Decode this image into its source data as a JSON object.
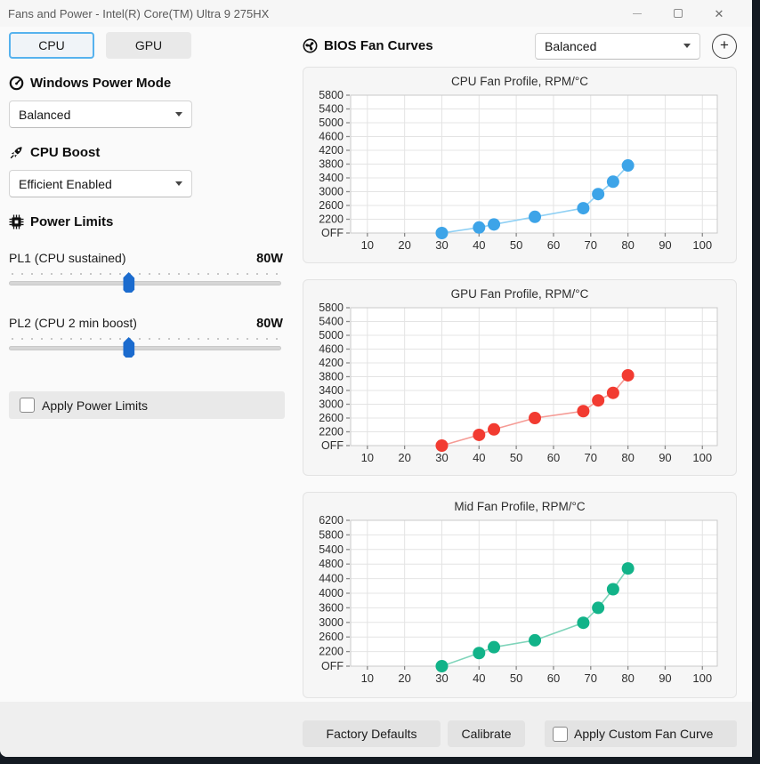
{
  "window": {
    "title": "Fans and Power - Intel(R) Core(TM) Ultra 9 275HX",
    "close_glyph": "✕"
  },
  "sidebar": {
    "tabs": [
      {
        "label": "CPU"
      },
      {
        "label": "GPU"
      }
    ],
    "active_tab": "CPU",
    "power_mode": {
      "heading": "Windows Power Mode",
      "value": "Balanced"
    },
    "cpu_boost": {
      "heading": "CPU Boost",
      "value": "Efficient Enabled"
    },
    "power_limits": {
      "heading": "Power Limits",
      "sliders": [
        {
          "label": "PL1 (CPU sustained)",
          "value": "80W",
          "percent": 44
        },
        {
          "label": "PL2 (CPU 2 min boost)",
          "value": "80W",
          "percent": 44
        }
      ],
      "apply_label": "Apply Power Limits",
      "apply_checked": false
    }
  },
  "fan_panel": {
    "heading": "BIOS Fan Curves",
    "preset": "Balanced",
    "add_glyph": "+",
    "footer": {
      "factory_defaults": "Factory Defaults",
      "calibrate": "Calibrate",
      "apply_custom": "Apply Custom Fan Curve",
      "apply_custom_checked": false
    }
  },
  "chart_data": [
    {
      "type": "scatter",
      "title": "CPU Fan Profile, RPM/°C",
      "x_ticks": [
        10,
        20,
        30,
        40,
        50,
        60,
        70,
        80,
        90,
        100
      ],
      "y_ticks_bottom_to_top": [
        "OFF",
        "2200",
        "2600",
        "3000",
        "3400",
        "3800",
        "4200",
        "4600",
        "5000",
        "5400",
        "5800"
      ],
      "points": [
        {
          "temp": 30,
          "rpm": "OFF"
        },
        {
          "temp": 40,
          "rpm": 1960
        },
        {
          "temp": 44,
          "rpm": 2050
        },
        {
          "temp": 55,
          "rpm": 2270
        },
        {
          "temp": 68,
          "rpm": 2520
        },
        {
          "temp": 72,
          "rpm": 2930
        },
        {
          "temp": 76,
          "rpm": 3290
        },
        {
          "temp": 80,
          "rpm": 3760
        }
      ],
      "point_color": "#3da4e8",
      "line_color": "#8fd0f4"
    },
    {
      "type": "scatter",
      "title": "GPU Fan Profile, RPM/°C",
      "x_ticks": [
        10,
        20,
        30,
        40,
        50,
        60,
        70,
        80,
        90,
        100
      ],
      "y_ticks_bottom_to_top": [
        "OFF",
        "2200",
        "2600",
        "3000",
        "3400",
        "3800",
        "4200",
        "4600",
        "5000",
        "5400",
        "5800"
      ],
      "points": [
        {
          "temp": 30,
          "rpm": "OFF"
        },
        {
          "temp": 40,
          "rpm": 2110
        },
        {
          "temp": 44,
          "rpm": 2270
        },
        {
          "temp": 55,
          "rpm": 2600
        },
        {
          "temp": 68,
          "rpm": 2800
        },
        {
          "temp": 72,
          "rpm": 3110
        },
        {
          "temp": 76,
          "rpm": 3330
        },
        {
          "temp": 80,
          "rpm": 3840
        }
      ],
      "point_color": "#f23b31",
      "line_color": "#f59b95"
    },
    {
      "type": "scatter",
      "title": "Mid Fan Profile, RPM/°C",
      "x_ticks": [
        10,
        20,
        30,
        40,
        50,
        60,
        70,
        80,
        90,
        100
      ],
      "y_ticks_bottom_to_top": [
        "OFF",
        "2200",
        "2600",
        "3000",
        "3600",
        "4000",
        "4400",
        "4800",
        "5400",
        "5800",
        "6200"
      ],
      "points": [
        {
          "temp": 30,
          "rpm": "OFF"
        },
        {
          "temp": 40,
          "rpm": 2160
        },
        {
          "temp": 44,
          "rpm": 2320
        },
        {
          "temp": 55,
          "rpm": 2510
        },
        {
          "temp": 68,
          "rpm": 2990
        },
        {
          "temp": 72,
          "rpm": 3600
        },
        {
          "temp": 76,
          "rpm": 4110
        },
        {
          "temp": 80,
          "rpm": 4680
        }
      ],
      "point_color": "#12b389",
      "line_color": "#7fd4ba"
    }
  ]
}
